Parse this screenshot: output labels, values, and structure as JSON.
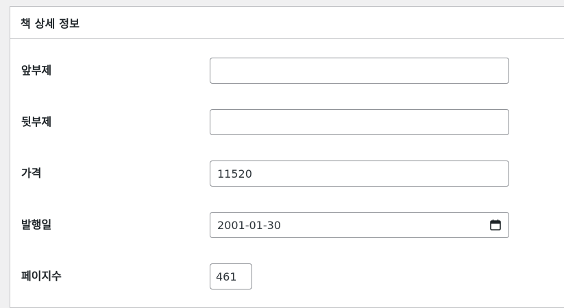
{
  "panel": {
    "title": "책 상세 정보"
  },
  "fields": {
    "front_subtitle": {
      "label": "앞부제",
      "value": ""
    },
    "back_subtitle": {
      "label": "뒷부제",
      "value": ""
    },
    "price": {
      "label": "가격",
      "value": "11520"
    },
    "publish_date": {
      "label": "발행일",
      "value": "2001-01-30",
      "icon": "calendar-icon"
    },
    "page_count": {
      "label": "페이지수",
      "value": "461"
    }
  }
}
